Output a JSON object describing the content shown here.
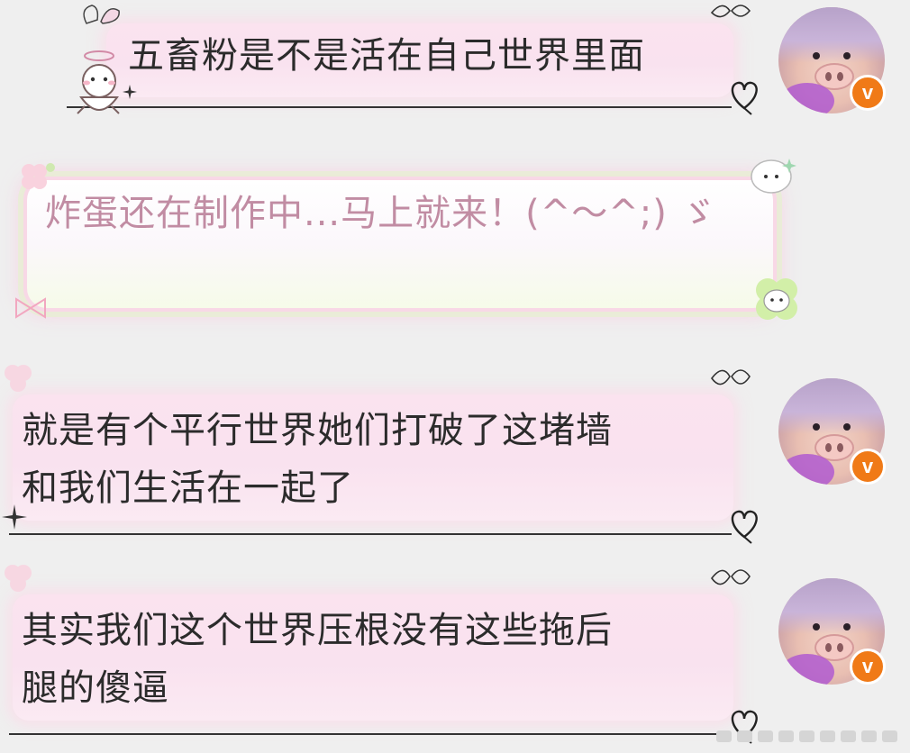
{
  "messages": [
    {
      "id": "m1",
      "text": "五畜粉是不是活在自己世界里面",
      "verified_badge": "v"
    },
    {
      "id": "m2",
      "text": "炸蛋还在制作中...马上就来！(^～^;) ゞ"
    },
    {
      "id": "m3",
      "text": "就是有个平行世界她们打破了这堵墙\n和我们生活在一起了",
      "verified_badge": "v"
    },
    {
      "id": "m4",
      "text": "其实我们这个世界压根没有这些拖后\n腿的傻逼",
      "verified_badge": "v"
    }
  ],
  "colors": {
    "background": "#efefef",
    "bubble_pink": "#fbe3ef",
    "sticker_text": "#c18ca3",
    "badge_orange": "#f07a17"
  },
  "icons": [
    "heart-doodle-icon",
    "butterfly-icon",
    "sparkle-icon",
    "clover-icon",
    "bow-icon",
    "sheep-sticker-icon",
    "page-dots-icon"
  ]
}
